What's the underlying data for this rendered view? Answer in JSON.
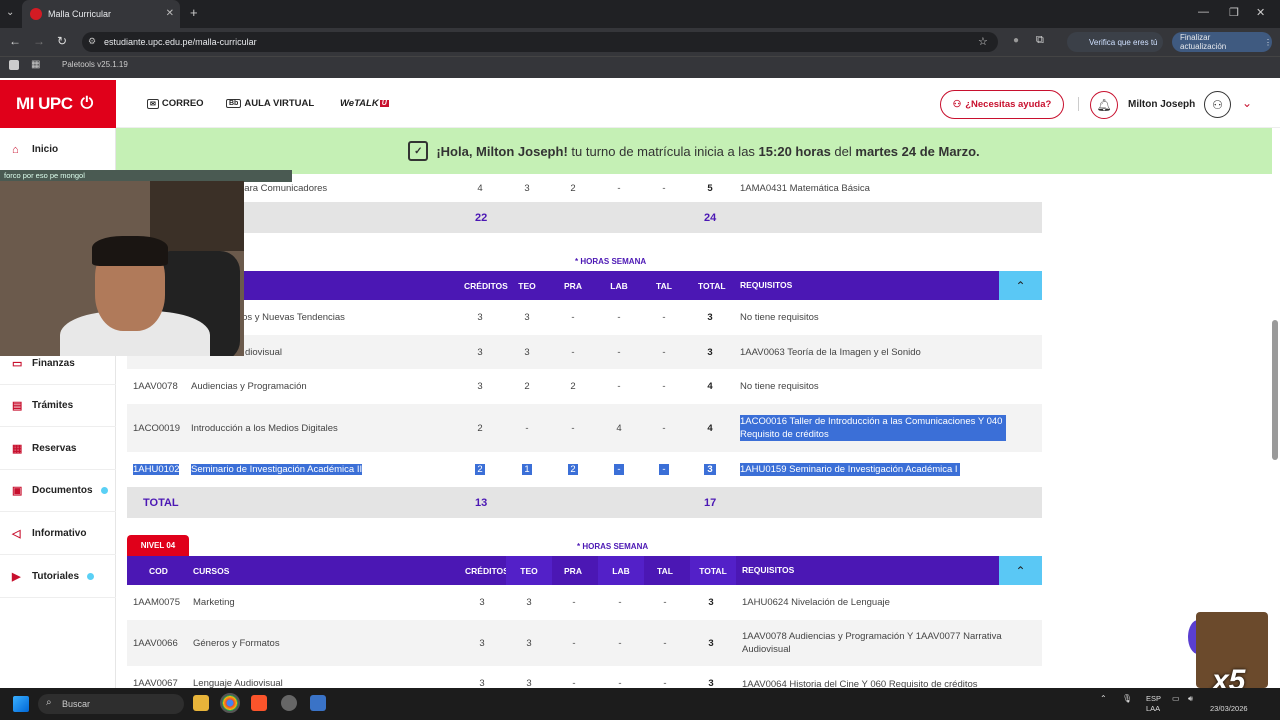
{
  "browser": {
    "tab_title": "Malla Curricular",
    "url": "estudiante.upc.edu.pe/malla-curricular",
    "verifica": "Verifica que eres tú",
    "finalizar": "Finalizar actualización",
    "bookmark": "Paletools v25.1.19"
  },
  "header": {
    "logo": "MI UPC",
    "links": [
      "CORREO",
      "AULA VIRTUAL",
      "WeTALK"
    ],
    "help": "¿Necesitas ayuda?",
    "user": "Milton Joseph"
  },
  "banner": {
    "greeting": "¡Hola, Milton Joseph!",
    "text1": " tu turno de matrícula inicia a las ",
    "time": "15:20 horas",
    "text2": " del ",
    "date": "martes 24 de Marzo."
  },
  "sidebar": {
    "items": [
      "Inicio",
      "Finanzas",
      "Trámites",
      "Reservas",
      "Documentos",
      "Informativo",
      "Tutoriales"
    ]
  },
  "stream": {
    "chat": "forco por eso pe mongol"
  },
  "table": {
    "headers": {
      "cod": "COD",
      "cursos": "CURSOS",
      "creditos": "CRÉDITOS",
      "teo": "TEO",
      "pra": "PRA",
      "lab": "LAB",
      "tal": "TAL",
      "total": "TOTAL",
      "requisitos": "REQUISITOS"
    },
    "horas": "* HORAS SEMANA",
    "total_label": "TOTAL",
    "top_row": {
      "curso": "para Comunicadores",
      "cred": "4",
      "teo": "3",
      "pra": "2",
      "lab": "-",
      "tal": "-",
      "tot": "5",
      "req": "1AMA0431 Matemática Básica"
    },
    "top_total": {
      "cred": "22",
      "tot": "24"
    },
    "level3_rows": [
      {
        "cod": "",
        "curso": "ios y Nuevas Tendencias",
        "cred": "3",
        "teo": "3",
        "pra": "-",
        "lab": "-",
        "tal": "-",
        "tot": "3",
        "req": "No tiene requisitos"
      },
      {
        "cod": "",
        "curso": "diovisual",
        "cred": "3",
        "teo": "3",
        "pra": "-",
        "lab": "-",
        "tal": "-",
        "tot": "3",
        "req": "1AAV0063 Teoría de la Imagen y el Sonido"
      },
      {
        "cod": "1AAV0078",
        "curso": "Audiencias y Programación",
        "cred": "3",
        "teo": "2",
        "pra": "2",
        "lab": "-",
        "tal": "-",
        "tot": "4",
        "req": "No tiene requisitos"
      },
      {
        "cod": "1ACO0019",
        "curso": "Introducción a los Medios Digitales",
        "cred": "2",
        "teo": "-",
        "pra": "-",
        "lab": "4",
        "tal": "-",
        "tot": "4",
        "req": "1ACO0016 Taller de Introducción a las Comunicaciones Y 040 Requisito de créditos"
      },
      {
        "cod": "1AHU0102",
        "curso": "Seminario de Investigación Académica II",
        "cred": "2",
        "teo": "1",
        "pra": "2",
        "lab": "-",
        "tal": "-",
        "tot": "3",
        "req": "1AHU0159 Seminario de Investigación Académica I"
      }
    ],
    "level3_total": {
      "cred": "13",
      "tot": "17"
    },
    "nivel4": "NIVEL 04",
    "level4_rows": [
      {
        "cod": "1AAM0075",
        "curso": "Marketing",
        "cred": "3",
        "teo": "3",
        "pra": "-",
        "lab": "-",
        "tal": "-",
        "tot": "3",
        "req": "1AHU0624 Nivelación de Lenguaje"
      },
      {
        "cod": "1AAV0066",
        "curso": "Géneros y Formatos",
        "cred": "3",
        "teo": "3",
        "pra": "-",
        "lab": "-",
        "tal": "-",
        "tot": "3",
        "req": "1AAV0078 Audiencias y Programación Y 1AAV0077 Narrativa Audiovisual"
      },
      {
        "cod": "1AAV0067",
        "curso": "Lenguaje Audiovisual",
        "cred": "3",
        "teo": "3",
        "pra": "-",
        "lab": "-",
        "tal": "-",
        "tot": "3",
        "req": "1AAV0064 Historia del Cine Y 060 Requisito de créditos"
      }
    ]
  },
  "taskbar": {
    "search": "Buscar",
    "lang": "ESP",
    "lang2": "LAA",
    "date": "23/03/2026"
  },
  "overlay": {
    "x5": "x5"
  },
  "colors": {
    "brand": "#e0001a",
    "header_purple": "#4b17b4",
    "banner_green": "#c5f0b5",
    "selection": "#3b6fd7"
  }
}
